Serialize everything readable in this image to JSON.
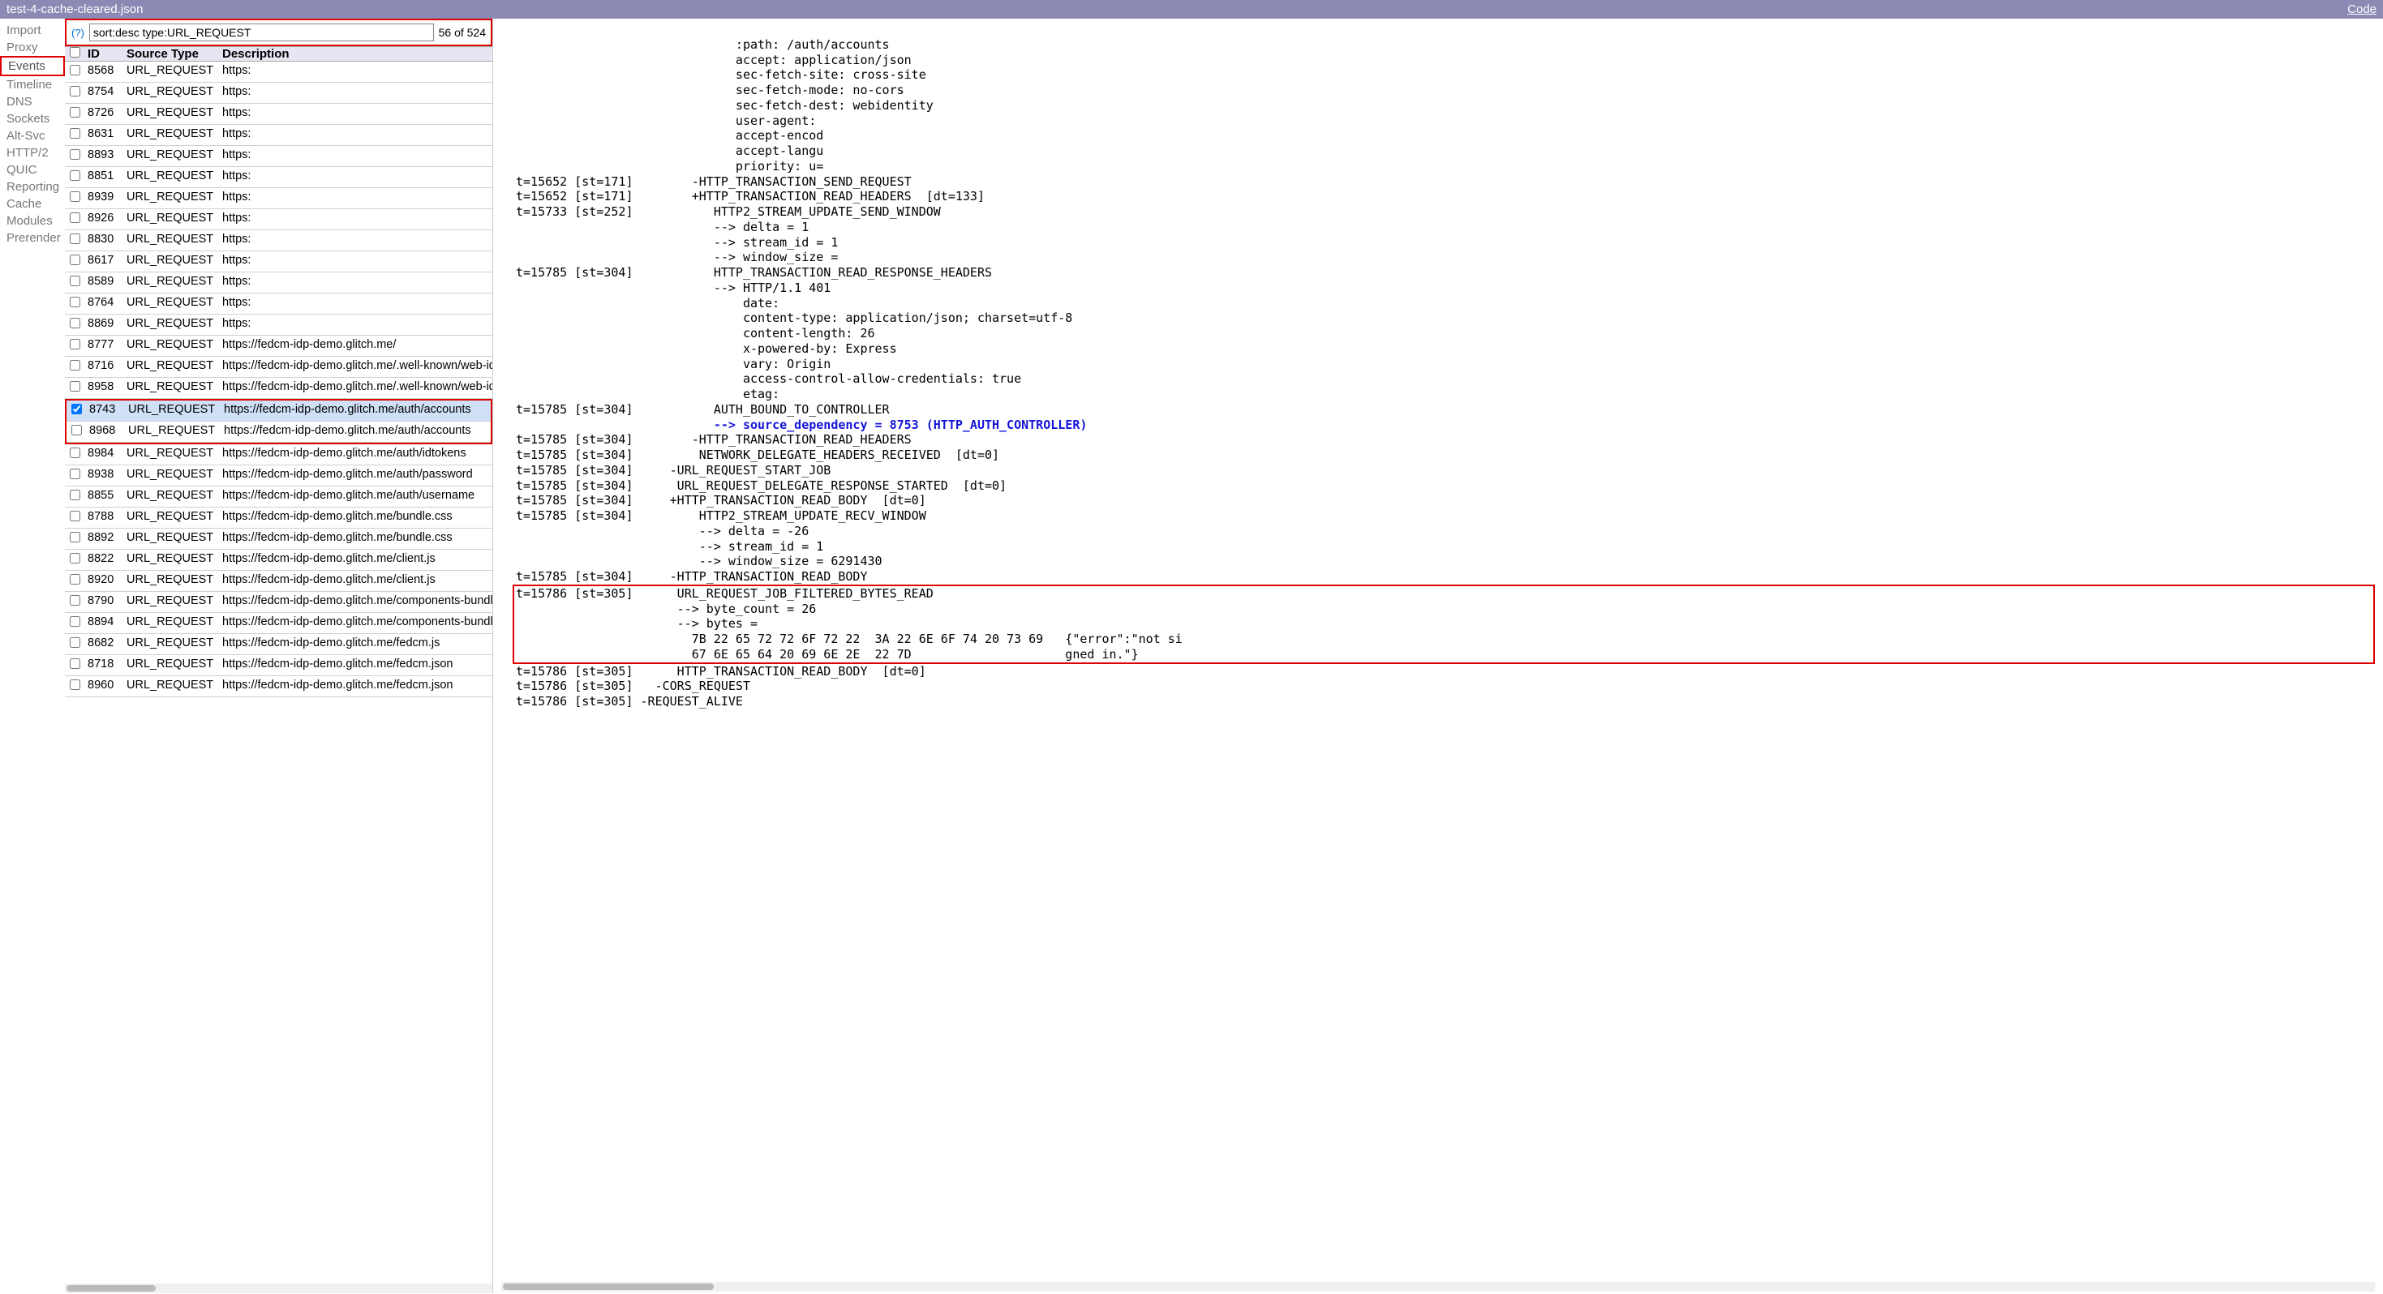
{
  "title": "test-4-cache-cleared.json",
  "code_link": "Code",
  "sidebar": {
    "items": [
      "Import",
      "Proxy",
      "Events",
      "Timeline",
      "DNS",
      "Sockets",
      "Alt-Svc",
      "HTTP/2",
      "QUIC",
      "Reporting",
      "Cache",
      "Modules",
      "Prerender"
    ],
    "active_index": 2
  },
  "search": {
    "help": "(?)",
    "value": "sort:desc type:URL_REQUEST",
    "count": "56 of 524"
  },
  "table": {
    "headers": {
      "id": "ID",
      "type": "Source Type",
      "desc": "Description"
    },
    "rows": [
      {
        "id": "8568",
        "type": "URL_REQUEST",
        "desc": "https:"
      },
      {
        "id": "8754",
        "type": "URL_REQUEST",
        "desc": "https:"
      },
      {
        "id": "8726",
        "type": "URL_REQUEST",
        "desc": "https:"
      },
      {
        "id": "8631",
        "type": "URL_REQUEST",
        "desc": "https:"
      },
      {
        "id": "8893",
        "type": "URL_REQUEST",
        "desc": "https:"
      },
      {
        "id": "8851",
        "type": "URL_REQUEST",
        "desc": "https:"
      },
      {
        "id": "8939",
        "type": "URL_REQUEST",
        "desc": "https:"
      },
      {
        "id": "8926",
        "type": "URL_REQUEST",
        "desc": "https:"
      },
      {
        "id": "8830",
        "type": "URL_REQUEST",
        "desc": "https:"
      },
      {
        "id": "8617",
        "type": "URL_REQUEST",
        "desc": "https:"
      },
      {
        "id": "8589",
        "type": "URL_REQUEST",
        "desc": "https:"
      },
      {
        "id": "8764",
        "type": "URL_REQUEST",
        "desc": "https:"
      },
      {
        "id": "8869",
        "type": "URL_REQUEST",
        "desc": "https:"
      },
      {
        "id": "8777",
        "type": "URL_REQUEST",
        "desc": "https://fedcm-idp-demo.glitch.me/"
      },
      {
        "id": "8716",
        "type": "URL_REQUEST",
        "desc": "https://fedcm-idp-demo.glitch.me/.well-known/web-iden"
      },
      {
        "id": "8958",
        "type": "URL_REQUEST",
        "desc": "https://fedcm-idp-demo.glitch.me/.well-known/web-iden"
      },
      {
        "id": "8743",
        "type": "URL_REQUEST",
        "desc": "https://fedcm-idp-demo.glitch.me/auth/accounts",
        "selected": true,
        "checked": true,
        "hl_group": 1
      },
      {
        "id": "8968",
        "type": "URL_REQUEST",
        "desc": "https://fedcm-idp-demo.glitch.me/auth/accounts",
        "hl_group": 1
      },
      {
        "id": "8984",
        "type": "URL_REQUEST",
        "desc": "https://fedcm-idp-demo.glitch.me/auth/idtokens"
      },
      {
        "id": "8938",
        "type": "URL_REQUEST",
        "desc": "https://fedcm-idp-demo.glitch.me/auth/password"
      },
      {
        "id": "8855",
        "type": "URL_REQUEST",
        "desc": "https://fedcm-idp-demo.glitch.me/auth/username"
      },
      {
        "id": "8788",
        "type": "URL_REQUEST",
        "desc": "https://fedcm-idp-demo.glitch.me/bundle.css"
      },
      {
        "id": "8892",
        "type": "URL_REQUEST",
        "desc": "https://fedcm-idp-demo.glitch.me/bundle.css"
      },
      {
        "id": "8822",
        "type": "URL_REQUEST",
        "desc": "https://fedcm-idp-demo.glitch.me/client.js"
      },
      {
        "id": "8920",
        "type": "URL_REQUEST",
        "desc": "https://fedcm-idp-demo.glitch.me/client.js"
      },
      {
        "id": "8790",
        "type": "URL_REQUEST",
        "desc": "https://fedcm-idp-demo.glitch.me/components-bundle.j"
      },
      {
        "id": "8894",
        "type": "URL_REQUEST",
        "desc": "https://fedcm-idp-demo.glitch.me/components-bundle.j"
      },
      {
        "id": "8682",
        "type": "URL_REQUEST",
        "desc": "https://fedcm-idp-demo.glitch.me/fedcm.js"
      },
      {
        "id": "8718",
        "type": "URL_REQUEST",
        "desc": "https://fedcm-idp-demo.glitch.me/fedcm.json"
      },
      {
        "id": "8960",
        "type": "URL_REQUEST",
        "desc": "https://fedcm-idp-demo.glitch.me/fedcm.json"
      }
    ]
  },
  "detail": {
    "pre1": "                              :path: /auth/accounts\n                              accept: application/json\n                              sec-fetch-site: cross-site\n                              sec-fetch-mode: no-cors\n                              sec-fetch-dest: webidentity\n                              user-agent:\n                              accept-encod\n                              accept-langu\n                              priority: u=\nt=15652 [st=171]        -HTTP_TRANSACTION_SEND_REQUEST\nt=15652 [st=171]        +HTTP_TRANSACTION_READ_HEADERS  [dt=133]\nt=15733 [st=252]           HTTP2_STREAM_UPDATE_SEND_WINDOW\n                           --> delta = 1\n                           --> stream_id = 1\n                           --> window_size =\nt=15785 [st=304]           HTTP_TRANSACTION_READ_RESPONSE_HEADERS\n                           --> HTTP/1.1 401\n                               date:\n                               content-type: application/json; charset=utf-8\n                               content-length: 26\n                               x-powered-by: Express\n                               vary: Origin\n                               access-control-allow-credentials: true\n                               etag:\nt=15785 [st=304]           AUTH_BOUND_TO_CONTROLLER",
    "src_dep": "                           --> source_dependency = 8753 (HTTP_AUTH_CONTROLLER)",
    "pre2": "t=15785 [st=304]        -HTTP_TRANSACTION_READ_HEADERS\nt=15785 [st=304]         NETWORK_DELEGATE_HEADERS_RECEIVED  [dt=0]\nt=15785 [st=304]     -URL_REQUEST_START_JOB\nt=15785 [st=304]      URL_REQUEST_DELEGATE_RESPONSE_STARTED  [dt=0]\nt=15785 [st=304]     +HTTP_TRANSACTION_READ_BODY  [dt=0]\nt=15785 [st=304]         HTTP2_STREAM_UPDATE_RECV_WINDOW\n                         --> delta = -26\n                         --> stream_id = 1\n                         --> window_size = 6291430\nt=15785 [st=304]     -HTTP_TRANSACTION_READ_BODY",
    "hl_block": "t=15786 [st=305]      URL_REQUEST_JOB_FILTERED_BYTES_READ\n                      --> byte_count = 26\n                      --> bytes =\n                        7B 22 65 72 72 6F 72 22  3A 22 6E 6F 74 20 73 69   {\"error\":\"not si\n                        67 6E 65 64 20 69 6E 2E  22 7D                     gned in.\"}",
    "pre3": "t=15786 [st=305]      HTTP_TRANSACTION_READ_BODY  [dt=0]\nt=15786 [st=305]   -CORS_REQUEST\nt=15786 [st=305] -REQUEST_ALIVE"
  }
}
